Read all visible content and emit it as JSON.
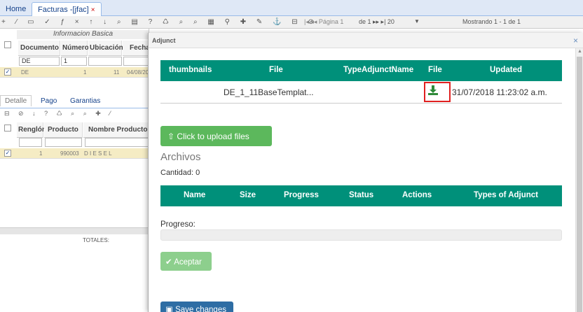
{
  "tabs": {
    "home": "Home",
    "active": "Facturas -[jfac]",
    "close": "×"
  },
  "toolbar": {
    "icons": "+ ⁄ ▭ ✓ ƒ × ↑ ↓ ⌕ ▤ ? ♺ ⌕ ⌕ ▦ ⚲ ✚ ✎ ⚓ ⊟ ⊘",
    "pager": "|◂ ◂◂ Página 1",
    "pageof": "de 1 ▸▸ ▸|  20",
    "dd": "▼",
    "showing": "Mostrando 1 - 1 de 1"
  },
  "grid": {
    "group": "Informacion Basica",
    "columns": [
      "Documento",
      "Número",
      "Ubicación",
      "Fecha"
    ],
    "filters": [
      "DE",
      "1"
    ],
    "row": {
      "doc": "DE",
      "num": "1",
      "ubic": "11",
      "fecha": "04/08/20"
    }
  },
  "subtabs": [
    "Detalle",
    "Pago",
    "Garantias"
  ],
  "subtoolbar": "⊟ ⊘ ↓ ? ♺ ⌕ ⌕ ✚ ⁄",
  "detail": {
    "columns": [
      "Renglón",
      "Producto",
      "Nombre Producto"
    ],
    "row": {
      "renglon": "1",
      "producto": "990003",
      "nombre": "D I E S E L"
    },
    "totales": "TOTALES:"
  },
  "modal": {
    "title": "Adjunct",
    "close": "×",
    "table1": {
      "headers": [
        "thumbnails",
        "File",
        "TypeAdjunctName",
        "File",
        "Updated"
      ],
      "row": {
        "file": "DE_1_11BaseTemplat...",
        "updated": "31/07/2018 11:23:02 a.m."
      }
    },
    "upload_label": "Click to upload files",
    "archivos": "Archivos",
    "cantidad": "Cantidad: 0",
    "table2": {
      "headers": [
        "Name",
        "Size",
        "Progress",
        "Status",
        "Actions",
        "Types of Adjunct"
      ]
    },
    "progreso": "Progreso:",
    "aceptar": "Aceptar",
    "save": "Save changes"
  },
  "colors": {
    "header_teal": "#00907a",
    "button_green": "#5cb85c",
    "highlight_red": "#e02020",
    "save_blue": "#2e6da4"
  }
}
